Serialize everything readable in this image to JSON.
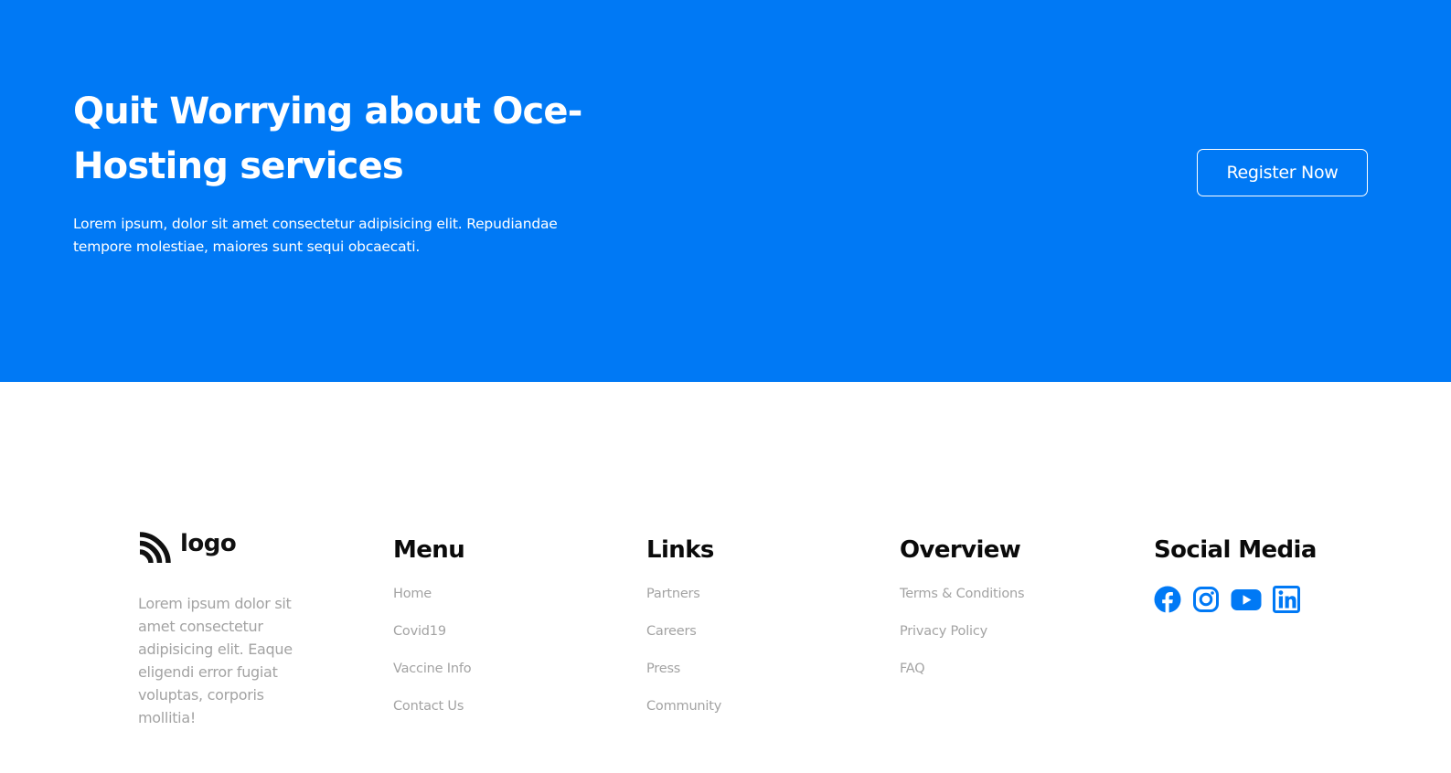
{
  "hero": {
    "title": "Quit Worrying about Oce-Hosting services",
    "text": "Lorem ipsum, dolor sit amet consectetur adipisicing elit. Repudiandae tempore molestiae, maiores sunt sequi obcaecati.",
    "button_label": "Register Now",
    "background_color": "#0079f5"
  },
  "footer": {
    "logo_text": "logo",
    "about_text": "Lorem ipsum dolor sit amet consectetur adipisicing elit. Eaque eligendi error fugiat voluptas, corporis mollitia!",
    "menu": {
      "title": "Menu",
      "items": [
        "Home",
        "Covid19",
        "Vaccine Info",
        "Contact Us"
      ]
    },
    "links": {
      "title": "Links",
      "items": [
        "Partners",
        "Careers",
        "Press",
        "Community"
      ]
    },
    "overview": {
      "title": "Overview",
      "items": [
        "Terms & Conditions",
        "Privacy Policy",
        "FAQ"
      ]
    },
    "social": {
      "title": "Social Media",
      "icons": [
        "facebook-icon",
        "instagram-icon",
        "youtube-icon",
        "linkedin-icon"
      ],
      "icon_color": "#0079f5"
    }
  }
}
